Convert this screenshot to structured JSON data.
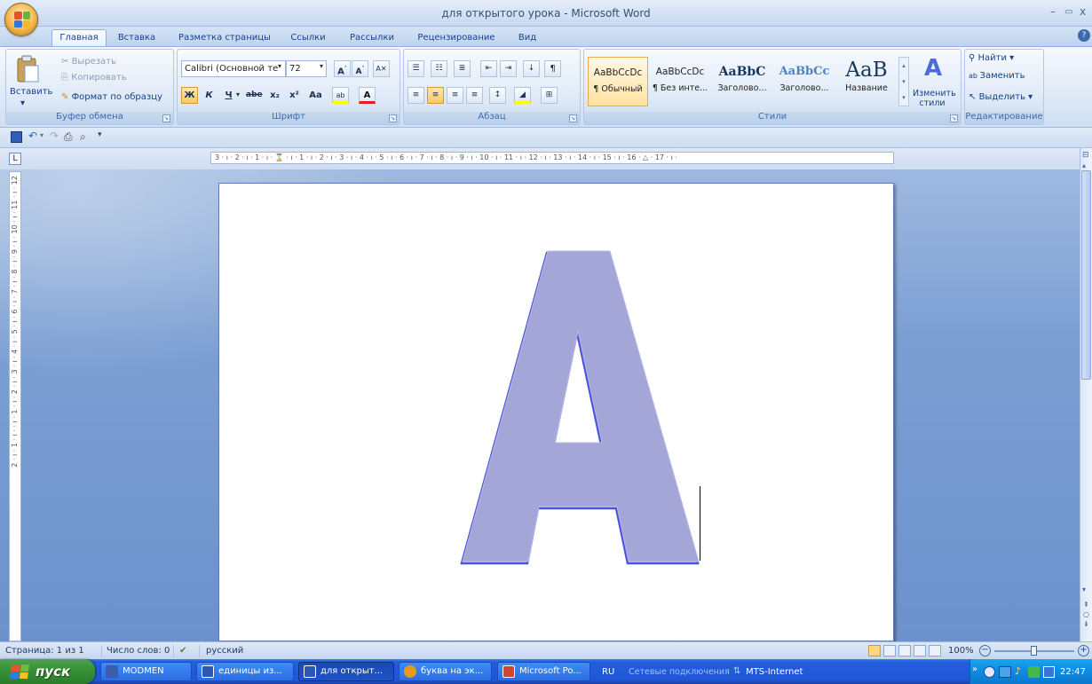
{
  "window": {
    "title": "для открытого урока - Microsoft Word",
    "controls": {
      "minimize": "–",
      "restore": "▭",
      "close": "x"
    }
  },
  "ribbon_tabs": [
    "Главная",
    "Вставка",
    "Разметка страницы",
    "Ссылки",
    "Рассылки",
    "Рецензирование",
    "Вид"
  ],
  "clipboard": {
    "paste": "Вставить",
    "cut": "Вырезать",
    "copy": "Копировать",
    "format_painter": "Формат по образцу",
    "group_label": "Буфер обмена"
  },
  "font": {
    "name": "Calibri (Основной те",
    "size": "72",
    "bold": "Ж",
    "italic": "К",
    "underline": "Ч",
    "strike": "abe",
    "subscript": "x₂",
    "superscript": "x²",
    "change_case": "Aa",
    "grow": "A",
    "shrink": "A",
    "group_label": "Шрифт"
  },
  "paragraph": {
    "group_label": "Абзац"
  },
  "styles": {
    "items": [
      {
        "sample": "AaBbCcDc",
        "name": "¶ Обычный"
      },
      {
        "sample": "AaBbCcDc",
        "name": "¶ Без инте..."
      },
      {
        "sample": "AaBbC",
        "name": "Заголово..."
      },
      {
        "sample": "AaBbCc",
        "name": "Заголово..."
      },
      {
        "sample": "AaB",
        "name": "Название"
      }
    ],
    "change_styles": "Изменить стили",
    "group_label": "Стили"
  },
  "editing": {
    "find": "Найти",
    "replace": "Заменить",
    "select": "Выделить",
    "group_label": "Редактирование"
  },
  "ruler_text": "3 · ı · 2 · ı · 1 · ı · ⌛ · ı · 1 · ı · 2 · ı · 3 · ı · 4 · ı · 5 · ı · 6 · ı · 7 · ı · 8 · ı · 9 · ı · 10 · ı · 11 · ı · 12 · ı · 13 · ı · 14 · ı · 15 · ı · 16 · △ · 17 · ı ·",
  "vruler_text": "2 · ı · 1 · ı · · ı · 1 · ı · 2 · ı · 3 · ı · 4 · ı · 5 · ı · 6 · ı · 7 · ı · 8 · ı · 9 · ı · 10 · ı · 11 · ı · 12",
  "document": {
    "letter": "A",
    "letter_color": "#a3a6d6",
    "outline_color": "#4c52e0"
  },
  "status": {
    "page": "Страница: 1 из 1",
    "words": "Число слов: 0",
    "language": "русский",
    "zoom": "100%"
  },
  "taskbar": {
    "start": "пуск",
    "items": [
      {
        "label": "MODMEN",
        "icon_color": "#3a5fa8"
      },
      {
        "label": "единицы из...",
        "icon_color": "#2b58b5"
      },
      {
        "label": "для открыт...",
        "icon_color": "#2b58b5"
      },
      {
        "label": "буква на эк...",
        "icon_color": "#e79a1c"
      },
      {
        "label": "Microsoft Po...",
        "icon_color": "#d0472d"
      }
    ],
    "lang": "RU",
    "network_label": "Сетевые подключения",
    "connection": "MTS-Internet",
    "clock": "22:47"
  },
  "colors": {
    "accent": "#15428b",
    "taskbar": "#245edc",
    "start": "#379337"
  }
}
